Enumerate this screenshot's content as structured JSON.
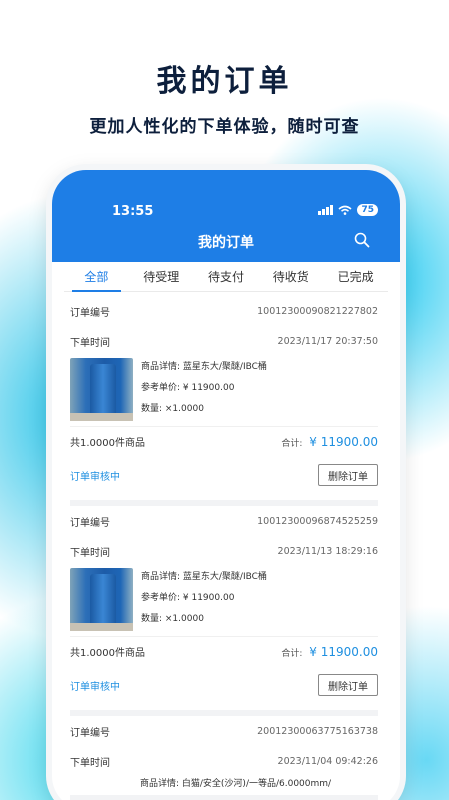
{
  "promo": {
    "headline": "我的订单",
    "subline": "更加人性化的下单体验，随时可查"
  },
  "status_bar": {
    "time": "13:55",
    "battery": "75"
  },
  "app": {
    "title": "我的订单"
  },
  "tabs": [
    {
      "label": "全部",
      "active": true
    },
    {
      "label": "待受理",
      "active": false
    },
    {
      "label": "待支付",
      "active": false
    },
    {
      "label": "待收货",
      "active": false
    },
    {
      "label": "已完成",
      "active": false
    }
  ],
  "labels": {
    "order_no": "订单编号",
    "order_time": "下单时间",
    "detail": "商品详情: ",
    "price": "参考单价: ",
    "qty": "数量: ",
    "total": "合计: ",
    "delete": "删除订单"
  },
  "orders": [
    {
      "order_no": "10012300090821227802",
      "time": "2023/11/17 20:37:50",
      "detail": "商品详情: 蓝星东大/聚醚/IBC桶",
      "price": "参考单价: ¥ 11900.00",
      "qty": "数量: ×1.0000",
      "count": "共1.0000件商品",
      "total_label": "合计: ",
      "total": "¥ 11900.00",
      "status": "订单审核中",
      "action": "删除订单"
    },
    {
      "order_no": "10012300096874525259",
      "time": "2023/11/13 18:29:16",
      "detail": "商品详情: 蓝星东大/聚醚/IBC桶",
      "price": "参考单价: ¥ 11900.00",
      "qty": "数量: ×1.0000",
      "count": "共1.0000件商品",
      "total_label": "合计: ",
      "total": "¥ 11900.00",
      "status": "订单审核中",
      "action": "删除订单"
    },
    {
      "order_no": "20012300063775163738",
      "time": "2023/11/04 09:42:26",
      "detail": "商品详情: 白猫/安全(沙河)/一等品/6.0000mm/"
    }
  ]
}
